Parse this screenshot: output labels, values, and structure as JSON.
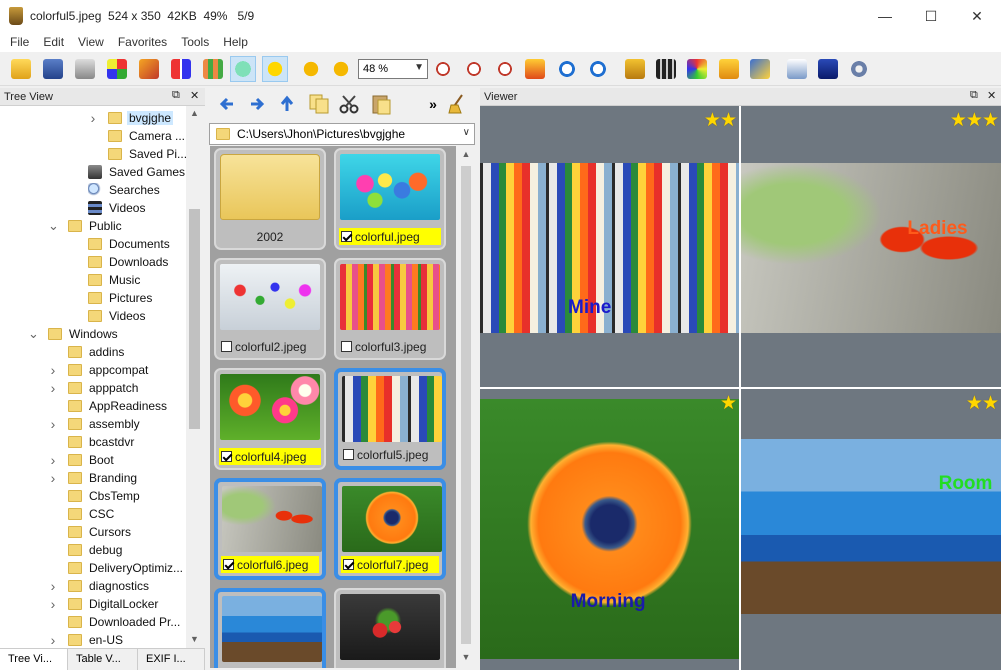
{
  "window": {
    "title": "colorful5.jpeg  524 x 350  42KB  49%   5/9",
    "controls": {
      "minimize": "—",
      "maximize": "☐",
      "close": "✕"
    }
  },
  "menu": [
    "File",
    "Edit",
    "View",
    "Favorites",
    "Tools",
    "Help"
  ],
  "toolbar": {
    "zoom_value": "48 %",
    "icons": [
      "open-folder-icon",
      "save-icon",
      "print-icon",
      "color-grid-icon",
      "slideshow-icon",
      "sort-icon",
      "thumbnails-icon",
      "comment-icon",
      "favorite-star-icon",
      "prev-arrow-icon",
      "next-arrow-icon",
      "zoom-in-icon",
      "zoom-out-icon",
      "zoom-actual-icon",
      "fit-window-icon",
      "rotate-right-icon",
      "rotate-left-icon",
      "crop-icon",
      "filmstrip-icon",
      "color-adjust-icon",
      "resize-icon",
      "effects-icon",
      "batch-icon",
      "camera-icon",
      "settings-gear-icon"
    ]
  },
  "tree_panel": {
    "title": "Tree View",
    "items": [
      {
        "label": "bvgjghe",
        "depth": 3,
        "expander": ">",
        "type": "folder",
        "selected": true
      },
      {
        "label": "Camera ...",
        "depth": 3,
        "expander": "",
        "type": "folder"
      },
      {
        "label": "Saved Pi...",
        "depth": 3,
        "expander": "",
        "type": "folder"
      },
      {
        "label": "Saved Games",
        "depth": 2,
        "expander": "",
        "type": "games"
      },
      {
        "label": "Searches",
        "depth": 2,
        "expander": "",
        "type": "search"
      },
      {
        "label": "Videos",
        "depth": 2,
        "expander": "",
        "type": "videos"
      },
      {
        "label": "Public",
        "depth": 1,
        "expander": "v",
        "type": "folder"
      },
      {
        "label": "Documents",
        "depth": 2,
        "expander": "",
        "type": "folder"
      },
      {
        "label": "Downloads",
        "depth": 2,
        "expander": "",
        "type": "folder"
      },
      {
        "label": "Music",
        "depth": 2,
        "expander": "",
        "type": "folder"
      },
      {
        "label": "Pictures",
        "depth": 2,
        "expander": "",
        "type": "folder"
      },
      {
        "label": "Videos",
        "depth": 2,
        "expander": "",
        "type": "folder"
      },
      {
        "label": "Windows",
        "depth": 0,
        "expander": "v",
        "type": "folder"
      },
      {
        "label": "addins",
        "depth": 1,
        "expander": "",
        "type": "folder"
      },
      {
        "label": "appcompat",
        "depth": 1,
        "expander": ">",
        "type": "folder"
      },
      {
        "label": "apppatch",
        "depth": 1,
        "expander": ">",
        "type": "folder"
      },
      {
        "label": "AppReadiness",
        "depth": 1,
        "expander": "",
        "type": "folder"
      },
      {
        "label": "assembly",
        "depth": 1,
        "expander": ">",
        "type": "folder"
      },
      {
        "label": "bcastdvr",
        "depth": 1,
        "expander": "",
        "type": "folder"
      },
      {
        "label": "Boot",
        "depth": 1,
        "expander": ">",
        "type": "folder"
      },
      {
        "label": "Branding",
        "depth": 1,
        "expander": ">",
        "type": "folder"
      },
      {
        "label": "CbsTemp",
        "depth": 1,
        "expander": "",
        "type": "folder"
      },
      {
        "label": "CSC",
        "depth": 1,
        "expander": "",
        "type": "folder"
      },
      {
        "label": "Cursors",
        "depth": 1,
        "expander": "",
        "type": "folder"
      },
      {
        "label": "debug",
        "depth": 1,
        "expander": "",
        "type": "folder"
      },
      {
        "label": "DeliveryOptimiz...",
        "depth": 1,
        "expander": "",
        "type": "folder"
      },
      {
        "label": "diagnostics",
        "depth": 1,
        "expander": ">",
        "type": "folder"
      },
      {
        "label": "DigitalLocker",
        "depth": 1,
        "expander": ">",
        "type": "folder"
      },
      {
        "label": "Downloaded Pr...",
        "depth": 1,
        "expander": "",
        "type": "folder"
      },
      {
        "label": "en-US",
        "depth": 1,
        "expander": ">",
        "type": "folder"
      }
    ]
  },
  "bottom_tabs": [
    "Tree Vi...",
    "Table V...",
    "EXIF I..."
  ],
  "browser": {
    "path": "C:\\Users\\Jhon\\Pictures\\bvgjghe",
    "thumbnails": [
      {
        "name": "2002",
        "kind": "folder",
        "checked": false,
        "selected": false
      },
      {
        "name": "colorful.jpeg",
        "kind": "balls",
        "checked": true,
        "selected": false
      },
      {
        "name": "colorful2.jpeg",
        "kind": "pins",
        "checked": false,
        "selected": false
      },
      {
        "name": "colorful3.jpeg",
        "kind": "tulips",
        "checked": false,
        "selected": false
      },
      {
        "name": "colorful4.jpeg",
        "kind": "flowers",
        "checked": true,
        "selected": false
      },
      {
        "name": "colorful5.jpeg",
        "kind": "surfboards",
        "checked": false,
        "selected": true
      },
      {
        "name": "colorful6.jpeg",
        "kind": "ladybugs",
        "checked": true,
        "selected": true
      },
      {
        "name": "colorful7.jpeg",
        "kind": "daisy",
        "checked": true,
        "selected": true
      },
      {
        "name": "",
        "kind": "pool",
        "checked": false,
        "selected": true
      },
      {
        "name": "",
        "kind": "berries",
        "checked": false,
        "selected": false
      }
    ]
  },
  "viewer": {
    "title": "Viewer",
    "cells": [
      {
        "kind": "surfboards",
        "rating": 2,
        "overlay": "Mine",
        "overlay_color": "#1a1acc"
      },
      {
        "kind": "ladybugs",
        "rating": 3,
        "overlay": "Ladies",
        "overlay_color": "#ff5a1a"
      },
      {
        "kind": "daisy",
        "rating": 1,
        "overlay": "Morning",
        "overlay_color": "#1a1aaa"
      },
      {
        "kind": "pool",
        "rating": 2,
        "overlay": "Room",
        "overlay_color": "#22dd22"
      }
    ]
  },
  "colors": {
    "selection_blue": "#3a8ee6",
    "check_yellow": "#ffff00",
    "star_gold": "#ffd700"
  }
}
